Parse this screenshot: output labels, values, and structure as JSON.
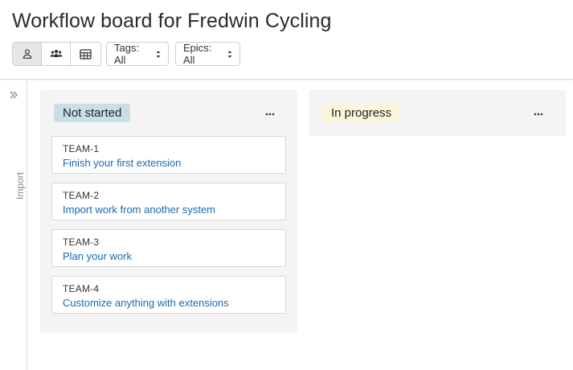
{
  "header": {
    "title": "Workflow board for Fredwin Cycling",
    "view_toggle": [
      {
        "icon": "person-icon",
        "active": true
      },
      {
        "icon": "people-icon",
        "active": false
      },
      {
        "icon": "table-icon",
        "active": false
      }
    ],
    "filters": {
      "tags": "Tags: All",
      "epics": "Epics: All"
    }
  },
  "rail": {
    "label": "Import",
    "icon": "double-chevron-right-icon"
  },
  "columns": [
    {
      "label": "Not started",
      "color": "#c8dfe6",
      "cards": [
        {
          "key": "TEAM-1",
          "title": "Finish your first extension"
        },
        {
          "key": "TEAM-2",
          "title": "Import work from another system"
        },
        {
          "key": "TEAM-3",
          "title": "Plan your work"
        },
        {
          "key": "TEAM-4",
          "title": "Customize anything with extensions"
        }
      ]
    },
    {
      "label": "In progress",
      "color": "#faf6dc",
      "cards": []
    }
  ],
  "colors": {
    "link": "#1a6ab1",
    "column_bg": "#f4f4f4"
  }
}
